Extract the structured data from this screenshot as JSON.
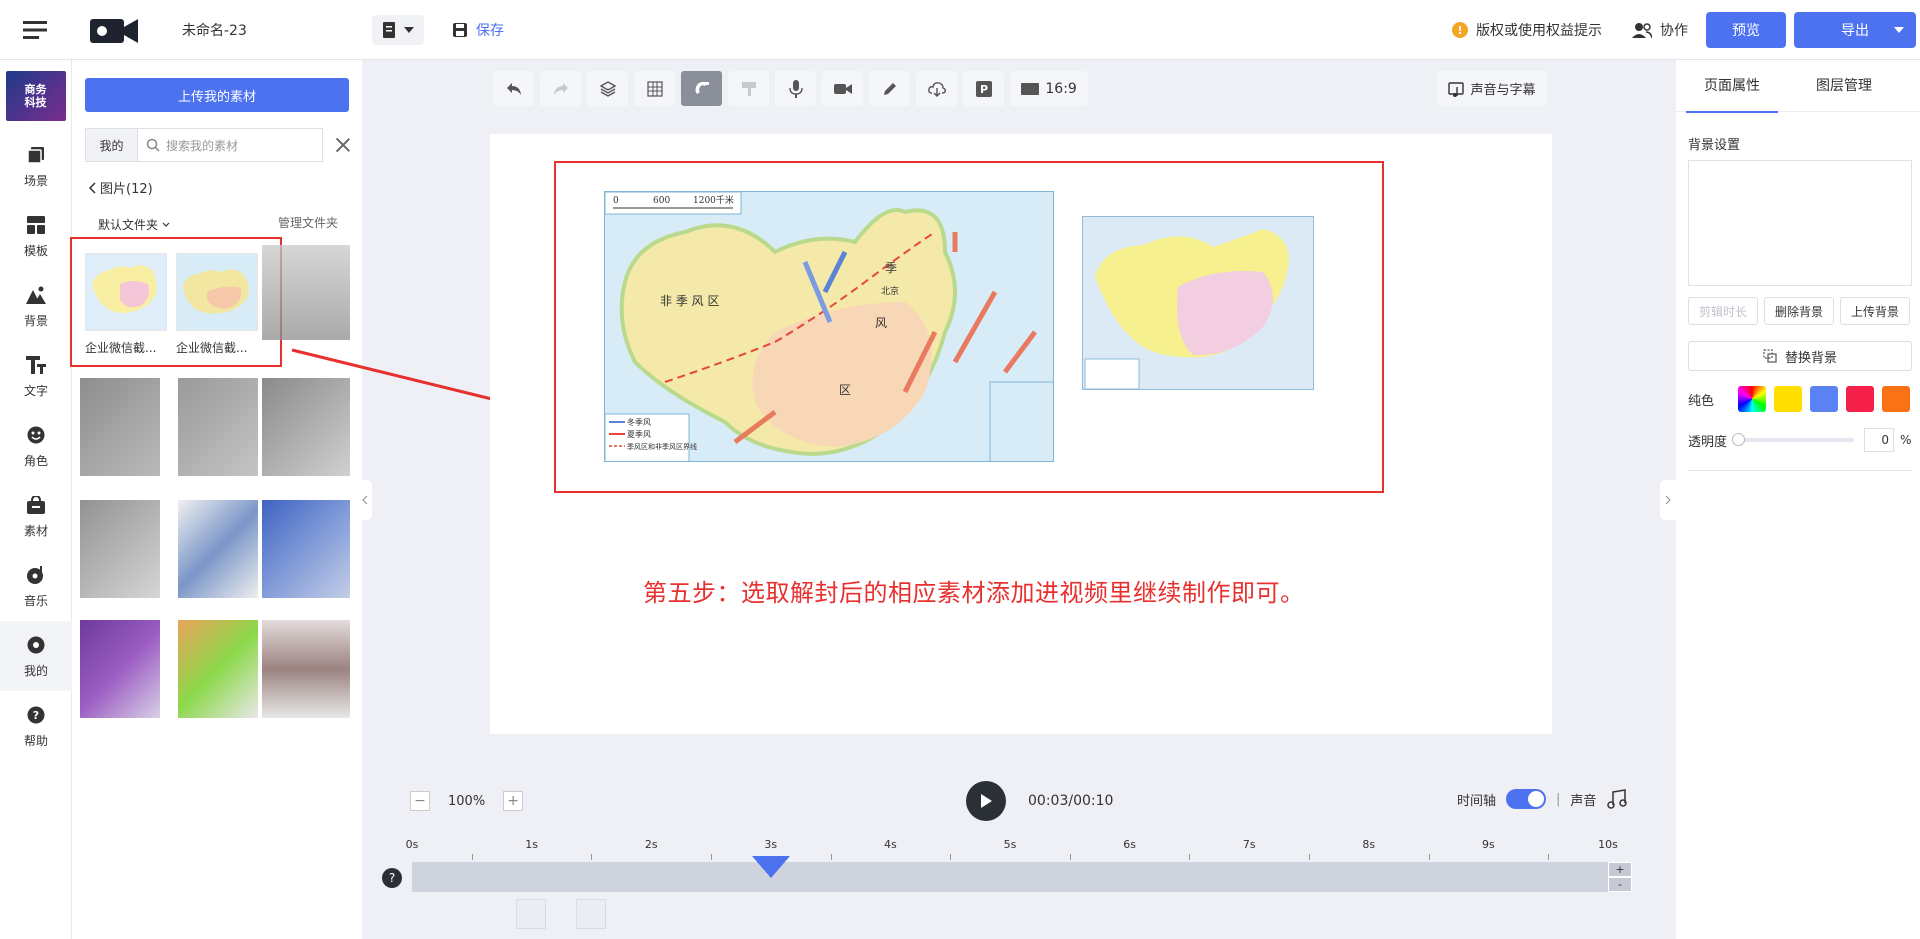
{
  "app": {
    "project_name": "未命名-23",
    "save_label": "保存",
    "notice_label": "版权或使用权益提示",
    "collab_label": "协作",
    "preview_label": "预览",
    "export_label": "导出"
  },
  "sidebar": {
    "brand_line1": "商务",
    "brand_line2": "科技",
    "items": [
      {
        "label": "场景",
        "icon": "scene-icon"
      },
      {
        "label": "模板",
        "icon": "template-icon"
      },
      {
        "label": "背景",
        "icon": "background-icon"
      },
      {
        "label": "文字",
        "icon": "text-icon"
      },
      {
        "label": "角色",
        "icon": "character-icon"
      },
      {
        "label": "素材",
        "icon": "material-icon"
      },
      {
        "label": "音乐",
        "icon": "music-icon"
      },
      {
        "label": "我的",
        "icon": "mine-icon"
      },
      {
        "label": "帮助",
        "icon": "help-icon"
      }
    ]
  },
  "material_panel": {
    "upload_label": "上传我的素材",
    "scope_label": "我的",
    "search_placeholder": "搜索我的素材",
    "breadcrumb": "图片(12)",
    "folder_label": "默认文件夹",
    "manage_folder_label": "管理文件夹",
    "items": [
      {
        "caption": "企业微信截..."
      },
      {
        "caption": "企业微信截..."
      }
    ]
  },
  "toolbar": {
    "ratio_label": "16:9",
    "subtitle_label": "声音与字幕"
  },
  "canvas": {
    "instruction_text": "第五步：选取解封后的相应素材添加进视频里继续制作即可。",
    "map_scale_0": "0",
    "map_scale_600": "600",
    "map_scale_1200": "1200千米",
    "map_region_label": "非 季 风 区",
    "map_legend_winter": "冬季风",
    "map_legend_summer": "夏季风",
    "map_legend_boundary": "季风区和非季风区界线",
    "map_char_ji": "季",
    "map_char_feng": "风",
    "map_char_qu": "区",
    "map_city": "北京"
  },
  "right_panel": {
    "tab_page": "页面属性",
    "tab_layers": "图层管理",
    "bg_title": "背景设置",
    "btn_trim": "剪辑时长",
    "btn_delete_bg": "删除背景",
    "btn_upload_bg": "上传背景",
    "replace_bg": "替换背景",
    "solid_label": "纯色",
    "opacity_label": "透明度",
    "opacity_value": "0",
    "opacity_unit": "%",
    "swatches": [
      "#ffde00",
      "#5b82f5",
      "#f5204a",
      "#f97316"
    ]
  },
  "playback": {
    "zoom_value": "100%",
    "time": "00:03/00:10",
    "timeline_label": "时间轴",
    "sound_label": "声音",
    "separator": "|",
    "ticks": [
      "0s",
      "1s",
      "2s",
      "3s",
      "4s",
      "5s",
      "6s",
      "7s",
      "8s",
      "9s",
      "10s"
    ],
    "plus": "+",
    "minus": "-"
  }
}
